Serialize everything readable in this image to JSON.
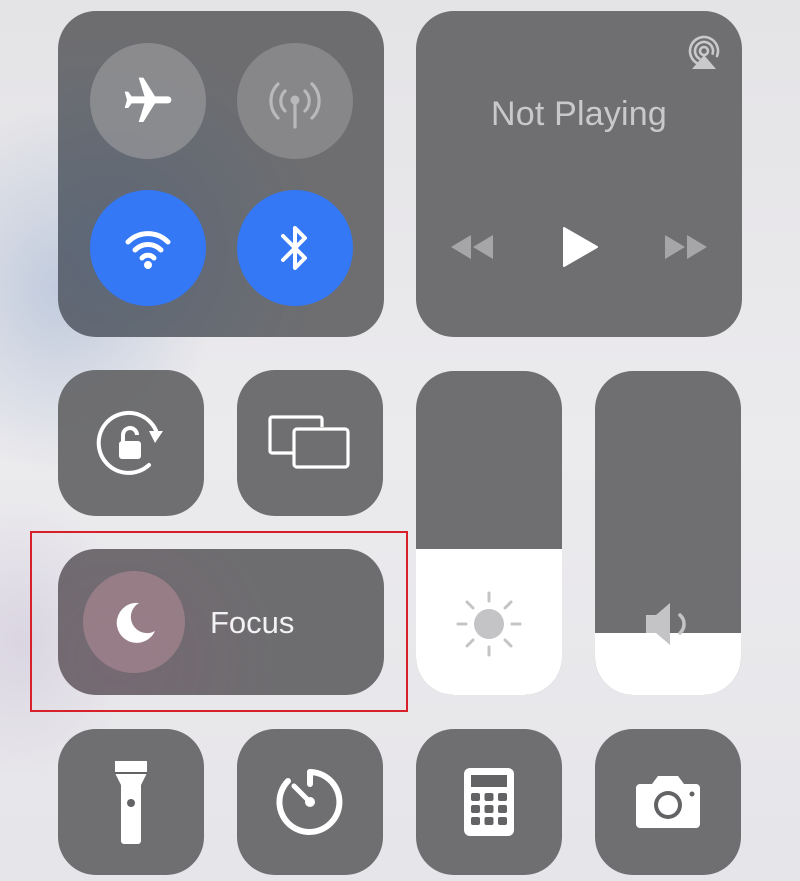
{
  "colors": {
    "accent_active": "#3478f6",
    "tile_bg": "#626264",
    "highlight_box": "#d8202a"
  },
  "connectivity": {
    "airplane": {
      "icon": "airplane-icon",
      "state": "off"
    },
    "cellular": {
      "icon": "cellular-antenna-icon",
      "state": "off"
    },
    "wifi": {
      "icon": "wifi-icon",
      "state": "on"
    },
    "bluetooth": {
      "icon": "bluetooth-icon",
      "state": "on"
    }
  },
  "media": {
    "title": "Not Playing",
    "airplay_icon": "airplay-icon",
    "controls": [
      "rewind-icon",
      "play-icon",
      "fast-forward-icon"
    ]
  },
  "controls": {
    "orientation_lock": "rotation-lock-icon",
    "screen_mirroring": "screen-mirroring-icon",
    "flashlight": "flashlight-icon",
    "timer": "timer-icon",
    "calculator": "calculator-icon",
    "camera": "camera-icon"
  },
  "focus": {
    "label": "Focus",
    "icon": "moon-icon"
  },
  "sliders": {
    "brightness": {
      "icon": "sun-icon",
      "level_percent": 45
    },
    "volume": {
      "icon": "speaker-icon",
      "level_percent": 19
    }
  }
}
